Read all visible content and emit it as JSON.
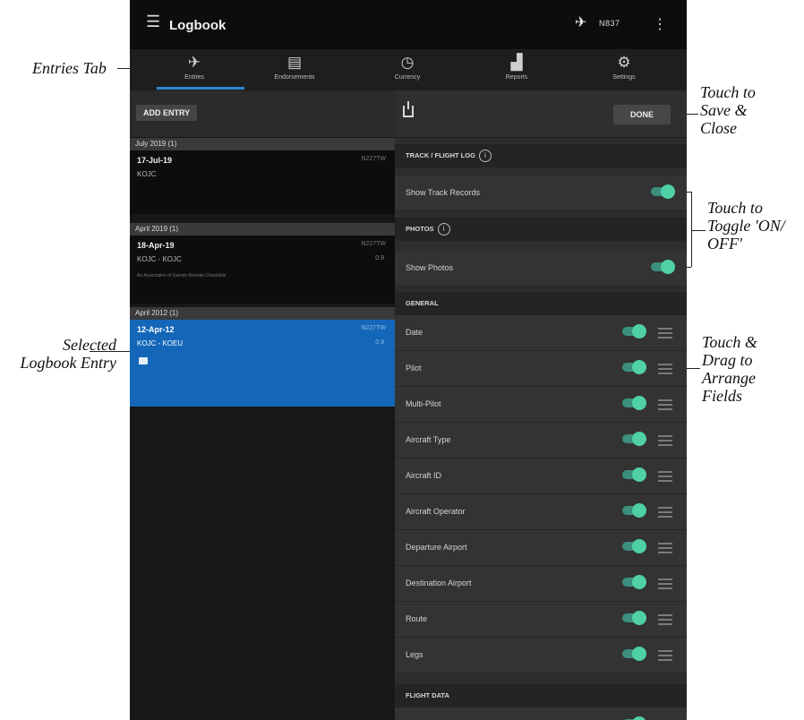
{
  "app": {
    "title": "Logbook",
    "menu_icon": "hamburger-icon",
    "aircraft_icon": "airplane-icon",
    "aircraft_tail": "N837",
    "more_icon": "vertical-dots-icon"
  },
  "tabs": [
    {
      "label": "Entries",
      "icon": "airplane-icon"
    },
    {
      "label": "Endorsements",
      "icon": "document-icon"
    },
    {
      "label": "Currency",
      "icon": "clock-icon"
    },
    {
      "label": "Reports",
      "icon": "chart-icon"
    },
    {
      "label": "Settings",
      "icon": "gear-icon"
    }
  ],
  "left": {
    "add_entry_label": "ADD ENTRY",
    "groups": [
      {
        "header": "July 2019 (1)",
        "entry": {
          "date": "17-Jul-19",
          "tail": "N227TW",
          "route": "KOJC",
          "hours": "",
          "note": ""
        }
      },
      {
        "header": "April 2019 (1)",
        "entry": {
          "date": "18-Apr-19",
          "tail": "N227TW",
          "route": "KOJC - KOJC",
          "hours": "0.9",
          "note": "An Association of Garmin Remote Checklists"
        }
      },
      {
        "header": "April 2012 (1)",
        "entry": {
          "date": "12-Apr-12",
          "tail": "N227TW",
          "route": "KOJC - KOEU",
          "hours": "0.9",
          "note": ""
        }
      }
    ]
  },
  "right": {
    "done_label": "DONE",
    "track_header": "TRACK / FLIGHT LOG",
    "track_row": "Show Track Records",
    "photos_header": "PHOTOS",
    "photos_row": "Show Photos",
    "general_header": "GENERAL",
    "general_rows": [
      "Date",
      "Pilot",
      "Multi-Pilot",
      "Aircraft Type",
      "Aircraft ID",
      "Aircraft Operator",
      "Departure Airport",
      "Destination Airport",
      "Route",
      "Legs"
    ],
    "flight_header": "FLIGHT DATA"
  },
  "annotations": {
    "entries_tab": "Entries Tab",
    "selected_entry_line1": "Selected",
    "selected_entry_line2": "Logbook Entry",
    "save_line1": "Touch to",
    "save_line2": "Save &",
    "save_line3": "Close",
    "toggle_line1": "Touch to",
    "toggle_line2": "Toggle 'ON/",
    "toggle_line3": "OFF'",
    "drag_line1": "Touch &",
    "drag_line2": "Drag to",
    "drag_line3": "Arrange",
    "drag_line4": "Fields"
  }
}
